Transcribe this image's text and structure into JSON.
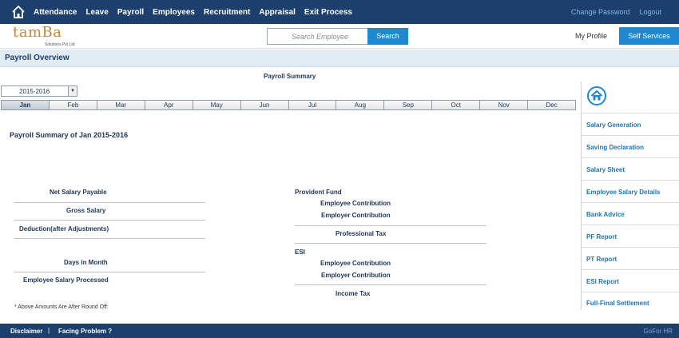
{
  "nav": {
    "menu": [
      "Attendance",
      "Leave",
      "Payroll",
      "Employees",
      "Recruitment",
      "Appraisal",
      "Exit Process"
    ],
    "change_password": "Change Password",
    "logout": "Logout"
  },
  "header": {
    "logo_word": "tamBa",
    "logo_sub": "Solutions Pvt Ltd",
    "search_placeholder": "Search Employee",
    "search_button": "Search",
    "my_profile": "My Profile",
    "self_services": "Self Services"
  },
  "page": {
    "title": "Payroll Overview",
    "summary_heading": "Payroll Summary",
    "year": "2015-2016",
    "months": [
      "Jan",
      "Feb",
      "Mar",
      "Apr",
      "May",
      "Jun",
      "Jul",
      "Aug",
      "Sep",
      "Oct",
      "Nov",
      "Dec"
    ],
    "active_month": "Jan",
    "section_title": "Payroll Summary of Jan 2015-2016",
    "left_fields": {
      "net_salary": "Net Salary Payable",
      "gross_salary": "Gross Salary",
      "deduction": "Deduction(after Adjustments)",
      "days_in_month": "Days in Month",
      "employee_salary_processed": "Employee Salary Processed"
    },
    "right_fields": {
      "provident_fund": "Provident Fund",
      "pf_employee": "Employee Contribution",
      "pf_employer": "Employer Contribution",
      "professional_tax": "Professional Tax",
      "esi": "ESI",
      "esi_employee": "Employee Contribution",
      "esi_employer": "Employer Contribution",
      "income_tax": "Income Tax"
    },
    "footnote": "* Above Amounts Are After Round Off:"
  },
  "right_panel": {
    "items": [
      "Salary Generation",
      "Saving Declaration",
      "Salary Sheet",
      "Employee Salary Details",
      "Bank Advice",
      "PF Report",
      "PT Report",
      "ESI Report",
      "Full-Final Settlement"
    ]
  },
  "footer": {
    "disclaimer": "Disclaimer",
    "separator": "|",
    "facing_problem": "Facing Problem ?",
    "watermark": "GoFor HR"
  },
  "colors": {
    "nav_bg": "#1c3f6e",
    "accent_blue": "#1e88d0",
    "logo_orange": "#c8853d",
    "link_blue": "#1f74b8"
  }
}
